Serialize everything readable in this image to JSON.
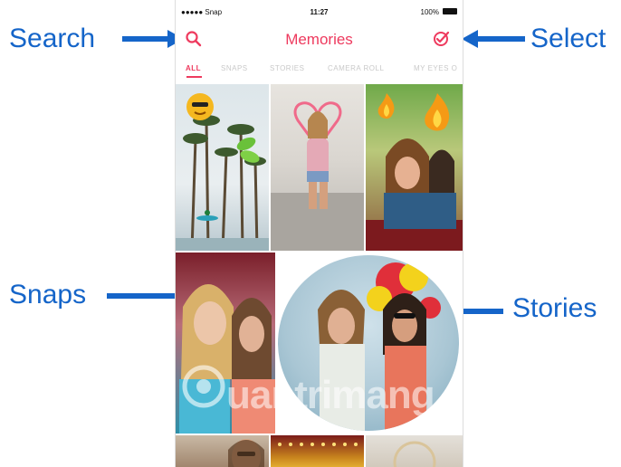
{
  "annotations": {
    "search": "Search",
    "select": "Select",
    "snaps": "Snaps",
    "stories": "Stories",
    "color": "#1565c9"
  },
  "status_bar": {
    "carrier": "●●●●● Snap",
    "time": "11:27",
    "battery": "100%"
  },
  "header": {
    "title": "Memories",
    "accent_color": "#ee3a5e",
    "left_icon": "search-icon",
    "right_icon": "select-checkmark-icon"
  },
  "tabs": [
    {
      "label": "ALL",
      "active": true
    },
    {
      "label": "SNAPS",
      "active": false
    },
    {
      "label": "STORIES",
      "active": false
    },
    {
      "label": "CAMERA ROLL",
      "active": false
    },
    {
      "label": "MY EYES O",
      "active": false
    }
  ],
  "watermark": {
    "text": "uantrimang"
  }
}
